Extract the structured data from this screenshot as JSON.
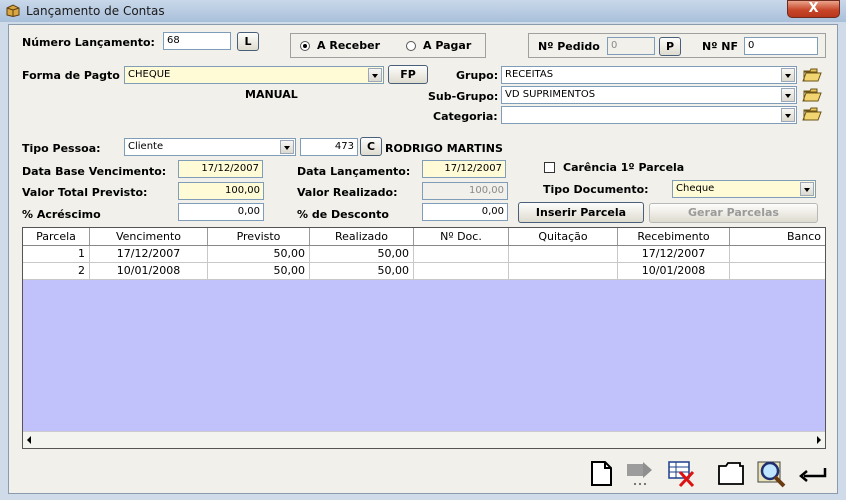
{
  "window": {
    "title": "Lançamento de Contas",
    "close_label": "X"
  },
  "numero_lancamento": {
    "label": "Número Lançamento:",
    "value": "68",
    "button": "L"
  },
  "tipo_conta": {
    "options": [
      "A Receber",
      "A Pagar"
    ],
    "selected": "A Receber"
  },
  "pedido": {
    "label": "Nº Pedido",
    "value": "0",
    "button": "P"
  },
  "nf": {
    "label": "Nº NF",
    "value": "0"
  },
  "forma_pagto": {
    "label": "Forma de Pagto",
    "value": "CHEQUE",
    "button": "FP",
    "mode": "MANUAL"
  },
  "grupo": {
    "label": "Grupo:",
    "value": "RECEITAS"
  },
  "sub_grupo": {
    "label": "Sub-Grupo:",
    "value": "VD SUPRIMENTOS"
  },
  "categoria": {
    "label": "Categoria:",
    "value": ""
  },
  "tipo_pessoa": {
    "label": "Tipo  Pessoa:",
    "value": "Cliente",
    "code": "473",
    "button": "C",
    "name": "RODRIGO MARTINS"
  },
  "data_base": {
    "label": "Data Base Vencimento:",
    "value": "17/12/2007"
  },
  "data_lancamento": {
    "label": "Data Lançamento:",
    "value": "17/12/2007"
  },
  "carencia": {
    "label": "Carência 1º Parcela"
  },
  "valor_previsto": {
    "label": "Valor Total Previsto:",
    "value": "100,00"
  },
  "valor_realizado": {
    "label": "Valor Realizado:",
    "value": "100,00"
  },
  "tipo_documento": {
    "label": "Tipo Documento:",
    "value": "Cheque"
  },
  "acrescimo": {
    "label": "% Acréscimo",
    "value": "0,00"
  },
  "desconto": {
    "label": "% de Desconto",
    "value": "0,00"
  },
  "buttons": {
    "inserir": "Inserir Parcela",
    "gerar": "Gerar Parcelas"
  },
  "table": {
    "headers": [
      "Parcela",
      "Vencimento",
      "Previsto",
      "Realizado",
      "Nº Doc.",
      "Quitação",
      "Recebimento",
      "Banco"
    ],
    "rows": [
      [
        "1",
        "17/12/2007",
        "50,00",
        "50,00",
        "",
        "",
        "17/12/2007",
        ""
      ],
      [
        "2",
        "10/01/2008",
        "50,00",
        "50,00",
        "",
        "",
        "10/01/2008",
        ""
      ]
    ]
  },
  "toolbar": [
    "new-document-icon",
    "disabled-action-icon",
    "delete-record-icon",
    "folder-icon",
    "search-icon",
    "return-icon"
  ]
}
